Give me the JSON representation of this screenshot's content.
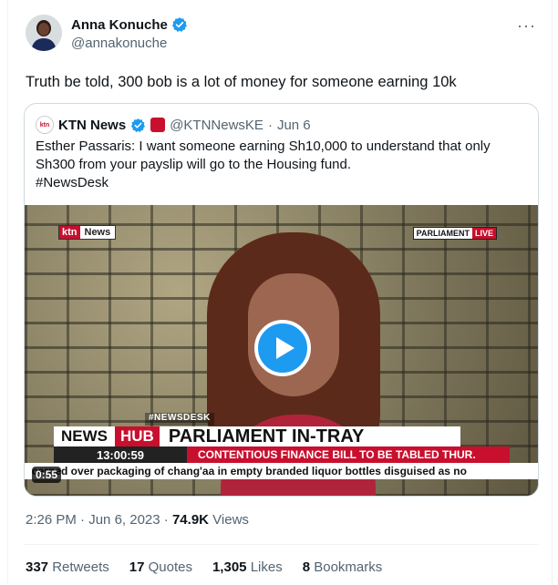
{
  "author": {
    "name": "Anna Konuche",
    "handle": "@annakonuche"
  },
  "more_label": "···",
  "tweet_text": "Truth be told, 300 bob is a lot of money for someone earning 10k",
  "quoted": {
    "logo_text": "ktn",
    "name": "KTN News",
    "handle": "@KTNNewsKE",
    "dot": "·",
    "date": "Jun 6",
    "text_line1": "Esther Passaris: I want someone earning Sh10,000 to understand that only",
    "text_line2": "Sh300 from your payslip will go to the Housing fund.",
    "hashtag": "#NewsDesk",
    "video": {
      "ktn_logo_red": "ktn",
      "ktn_logo_dark": "News",
      "parliament": "PARLIAMENT",
      "live": "LIVE",
      "hashtag_overlay": "#NEWSDESK",
      "news": "NEWS",
      "hub": "HUB",
      "headline": "PARLIAMENT IN-TRAY",
      "time": "13:00:59",
      "subheadline": "CONTENTIOUS FINANCE BILL TO BE TABLED THUR.",
      "crawl": "cerned over packaging of chang'aa in empty branded liquor bottles disguised as no",
      "duration": "0:55"
    }
  },
  "meta": {
    "time": "2:26 PM",
    "dot1": " · ",
    "date": "Jun 6, 2023",
    "dot2": " · ",
    "views_count": "74.9K",
    "views_label": " Views"
  },
  "stats": [
    {
      "count": "337",
      "label": "Retweets"
    },
    {
      "count": "17",
      "label": "Quotes"
    },
    {
      "count": "1,305",
      "label": "Likes"
    },
    {
      "count": "8",
      "label": "Bookmarks"
    }
  ],
  "colors": {
    "accent": "#1d9bf0",
    "ktn_red": "#c8102e",
    "muted_text": "#536471",
    "border": "#cfd9de"
  }
}
